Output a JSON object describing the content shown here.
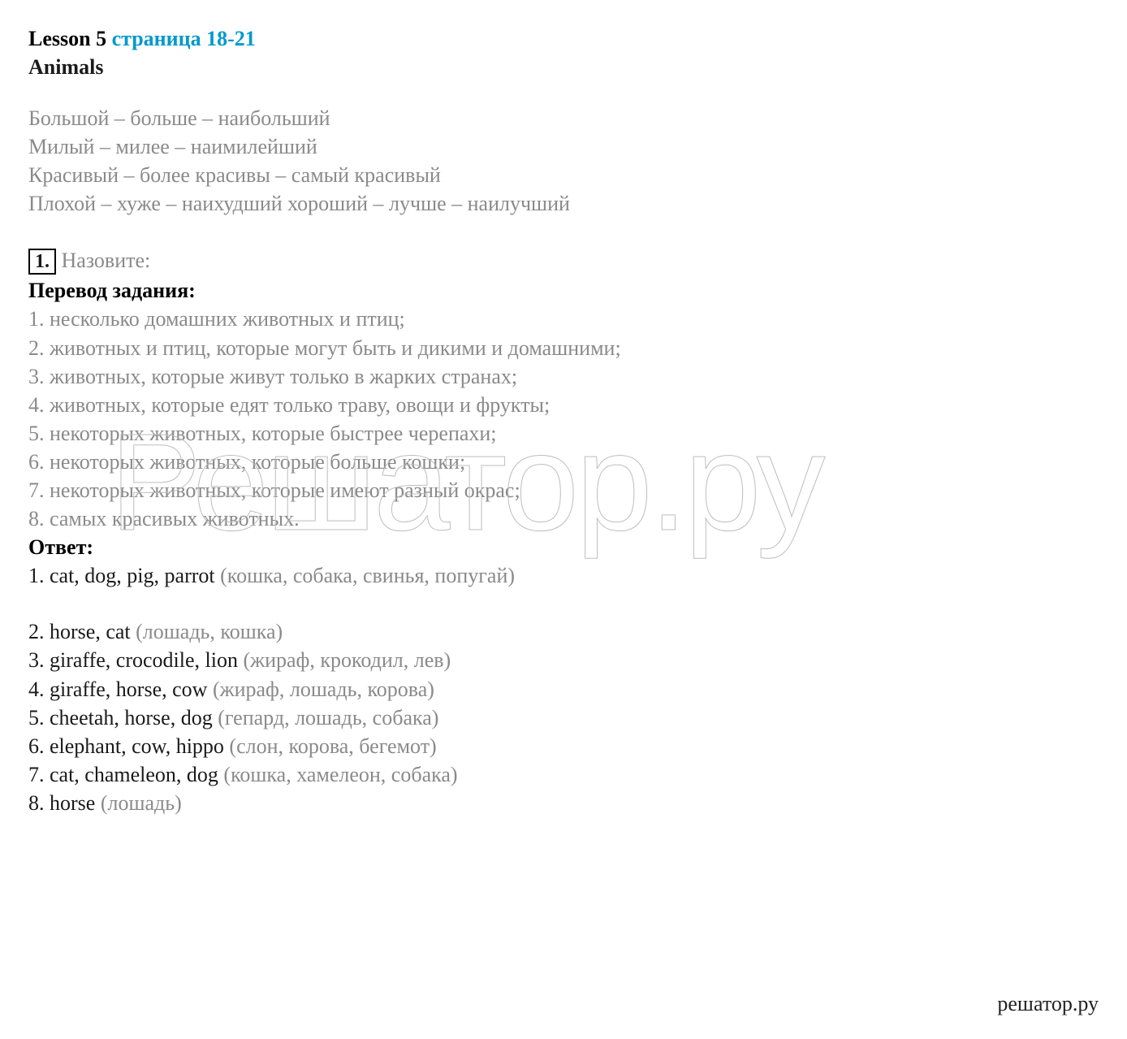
{
  "title": {
    "lesson_black": "Lesson 5 ",
    "lesson_blue": "страница 18-21"
  },
  "subtitle": "Animals",
  "grammar": [
    "Большой – больше – наибольший",
    "Милый – милее – наимилейший",
    "Красивый – более красивы – самый красивый",
    "Плохой – хуже – наихудший хороший – лучше – наилучший"
  ],
  "task": {
    "number": "1.",
    "prompt": " Назовите:"
  },
  "translation_heading": "Перевод задания:",
  "translation_items": [
    "1. несколько домашних животных и птиц;",
    "2. животных и птиц, которые могут быть и дикими и домашними;",
    "3. животных, которые живут только в жарких странах;",
    "4. животных, которые едят только траву, овощи и фрукты;",
    "5. некоторых животных, которые быстрее черепахи;",
    "6. некоторых животных, которые больше кошки;",
    "7. некоторых животных, которые имеют разный окрас;",
    "8. самых красивых животных."
  ],
  "answer_heading": "Ответ:",
  "answers": [
    {
      "main": "1. cat, dog, pig, parrot ",
      "paren": "(кошка, собака, свинья, попугай)",
      "gap": true
    },
    {
      "main": "2. horse, cat ",
      "paren": "(лошадь, кошка)"
    },
    {
      "main": "3. giraffe, crocodile, lion ",
      "paren": "(жираф, крокодил, лев)"
    },
    {
      "main": "4. giraffe, horse, cow ",
      "paren": "(жираф, лошадь, корова)"
    },
    {
      "main": "5. cheetah, horse, dog ",
      "paren": "(гепард, лошадь, собака)"
    },
    {
      "main": "6. elephant, cow, hippo ",
      "paren": "(слон, корова, бегемот)"
    },
    {
      "main": "7. cat, chameleon, dog ",
      "paren": "(кошка, хамелеон, собака)"
    },
    {
      "main": "8. horse ",
      "paren": "(лошадь)"
    }
  ],
  "watermark": "Решатор.ру",
  "footer_brand": "решатор.ру"
}
